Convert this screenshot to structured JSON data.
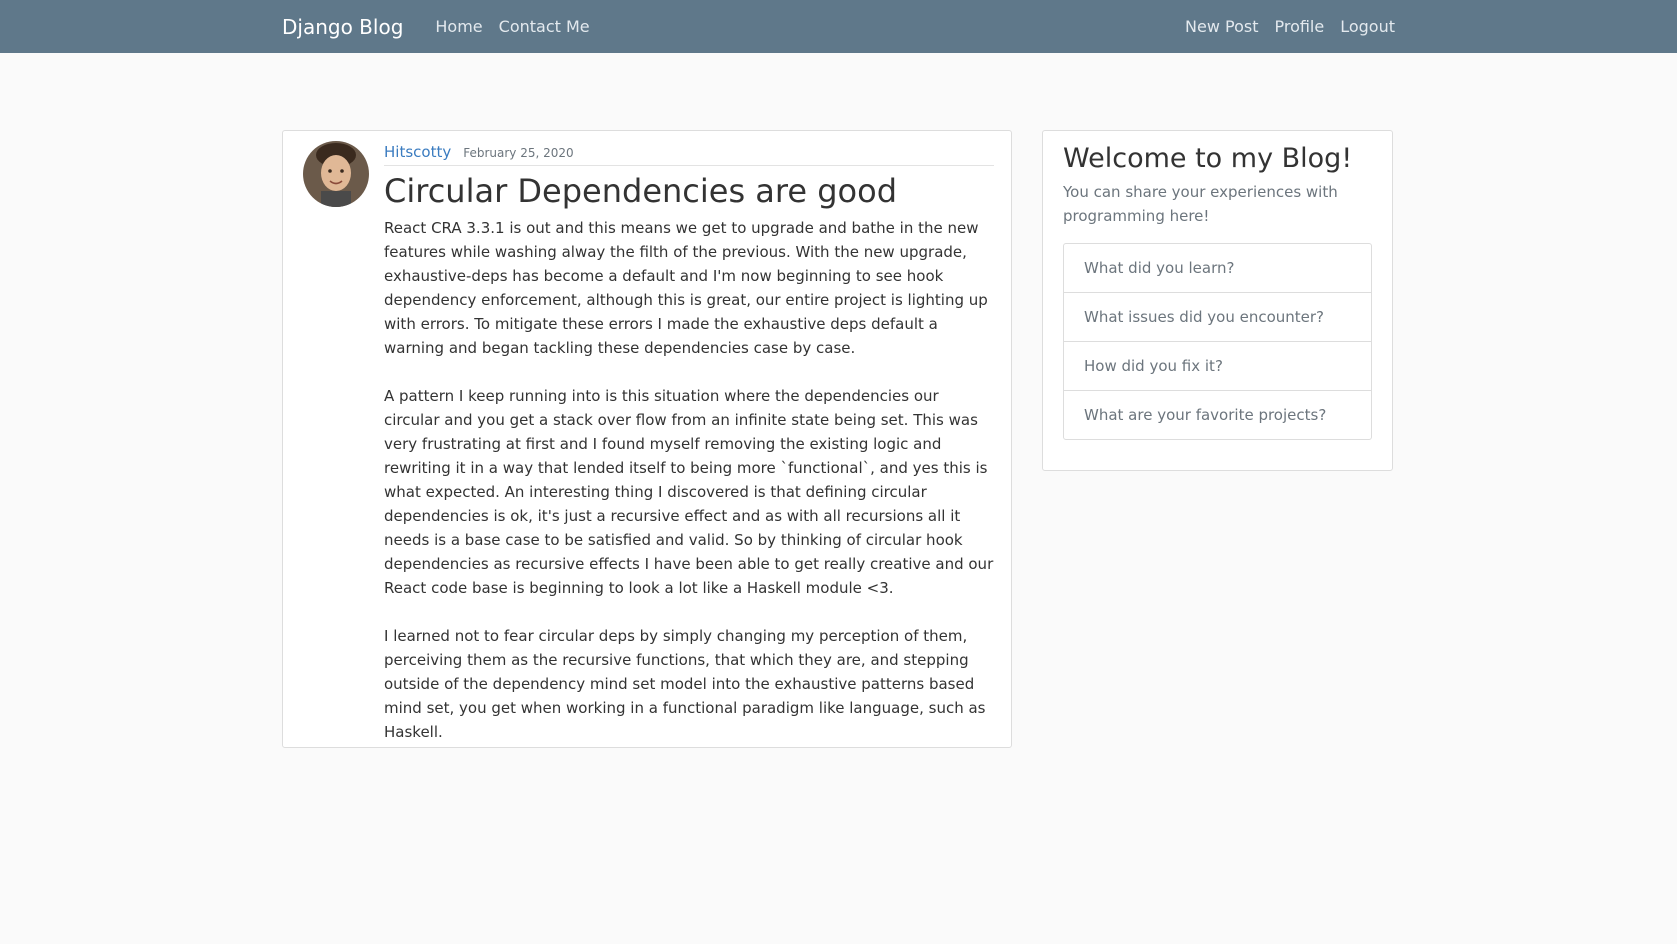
{
  "nav": {
    "brand": "Django Blog",
    "left_links": [
      "Home",
      "Contact Me"
    ],
    "right_links": [
      "New Post",
      "Profile",
      "Logout"
    ]
  },
  "post": {
    "author": "Hitscotty",
    "date": "February 25, 2020",
    "title": "Circular Dependencies are good",
    "paragraphs": [
      "React CRA 3.3.1 is out and this means we get to upgrade and bathe in the new features while washing alway the filth of the previous. With the new upgrade, exhaustive-deps has become a default and I'm now beginning to see hook dependency enforcement, although this is great, our entire project is lighting up with errors. To mitigate these errors I made the exhaustive deps default a warning and began tackling these dependencies case by case.",
      "A pattern I keep running into is this situation where the dependencies our circular and you get a stack over flow from an infinite state being set. This was very frustrating at first and I found myself removing the existing logic and rewriting it in a way that lended itself to being more `functional`, and yes this is what expected. An interesting thing I discovered is that defining circular dependencies is ok, it's just a recursive effect and as with all recursions all it needs is a base case to be satisfied and valid. So by thinking of circular hook dependencies as recursive effects I have been able to get really creative and our React code base is beginning to look a lot like a Haskell module <3.",
      "I learned not to fear circular deps by simply changing my perception of them, perceiving them as the recursive functions, that which they are, and stepping outside of the dependency mind set model into the exhaustive patterns based mind set, you get when working in a functional paradigm like language, such as Haskell."
    ]
  },
  "sidebar": {
    "title": "Welcome to my Blog!",
    "description": "You can share your experiences with programming here!",
    "items": [
      "What did you learn?",
      "What issues did you encounter?",
      "How did you fix it?",
      "What are your favorite projects?"
    ]
  },
  "colors": {
    "navbar_bg": "#5f788a",
    "link": "#3b7cc0"
  }
}
